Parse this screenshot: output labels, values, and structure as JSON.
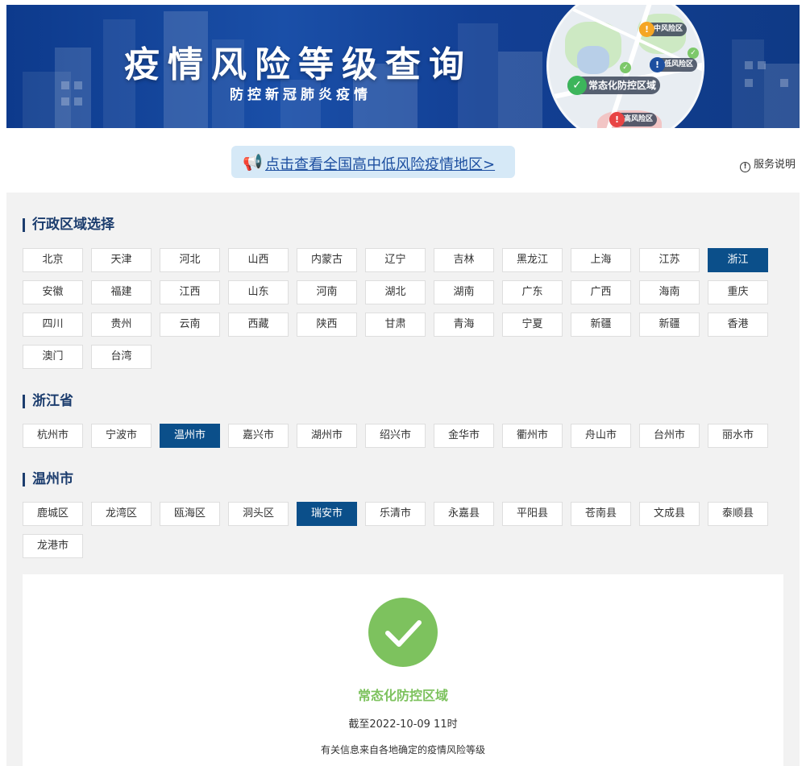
{
  "banner": {
    "title": "疫情风险等级查询",
    "subtitle": "防控新冠肺炎疫情",
    "map_tags": {
      "medium": "中风险区",
      "low": "低风险区",
      "normal": "常态化防控区域",
      "high": "高风险区"
    }
  },
  "notice": {
    "link_text": "点击查看全国高中低风险疫情地区>",
    "service_text": "服务说明"
  },
  "province_section": {
    "title": "行政区域选择",
    "selected": "浙江",
    "items": [
      "北京",
      "天津",
      "河北",
      "山西",
      "内蒙古",
      "辽宁",
      "吉林",
      "黑龙江",
      "上海",
      "江苏",
      "浙江",
      "安徽",
      "福建",
      "江西",
      "山东",
      "河南",
      "湖北",
      "湖南",
      "广东",
      "广西",
      "海南",
      "重庆",
      "四川",
      "贵州",
      "云南",
      "西藏",
      "陕西",
      "甘肃",
      "青海",
      "宁夏",
      "新疆",
      "新疆",
      "香港",
      "澳门",
      "台湾"
    ]
  },
  "city_section": {
    "title": "浙江省",
    "selected": "温州市",
    "items": [
      "杭州市",
      "宁波市",
      "温州市",
      "嘉兴市",
      "湖州市",
      "绍兴市",
      "金华市",
      "衢州市",
      "舟山市",
      "台州市",
      "丽水市"
    ]
  },
  "district_section": {
    "title": "温州市",
    "selected": "瑞安市",
    "items": [
      "鹿城区",
      "龙湾区",
      "瓯海区",
      "洞头区",
      "瑞安市",
      "乐清市",
      "永嘉县",
      "平阳县",
      "苍南县",
      "文成县",
      "泰顺县",
      "龙港市"
    ]
  },
  "result": {
    "level": "常态化防控区域",
    "time": "截至2022-10-09 11时",
    "source": "有关信息来自各地确定的疫情风险等级",
    "color": "#7dc25e"
  },
  "colors": {
    "selected_bg": "#0b4f8a",
    "title_color": "#1c3d6e",
    "link_color": "#1d4fa0"
  }
}
